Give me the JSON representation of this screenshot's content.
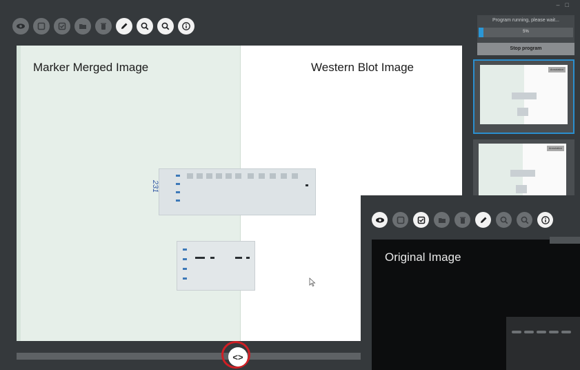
{
  "viewer": {
    "left_caption": "Marker Merged Image",
    "right_caption": "Western Blot Image",
    "handwritten_label": "231"
  },
  "toolbar": {
    "buttons": [
      "eye-icon",
      "square-icon",
      "checkbox-icon",
      "folder-icon",
      "trash-icon",
      "pencil-icon",
      "zoom-in-icon",
      "zoom-out-icon",
      "info-icon"
    ],
    "active": [
      "pencil-icon",
      "zoom-in-icon",
      "zoom-out-icon",
      "info-icon"
    ]
  },
  "side_panel": {
    "progress_text": "Program running, please wait...",
    "progress_percent": "5%",
    "progress_fraction": 0.05,
    "stop_button": "Stop program",
    "thumbnail_badge": "Annotation"
  },
  "overlay": {
    "caption": "Original Image"
  },
  "slider": {
    "handle_glyph": "<>"
  },
  "colors": {
    "accent": "#2b8fcf",
    "highlight_ring": "#d01e24",
    "left_panel": "#e6efe9",
    "dark_bg": "#35393c"
  }
}
